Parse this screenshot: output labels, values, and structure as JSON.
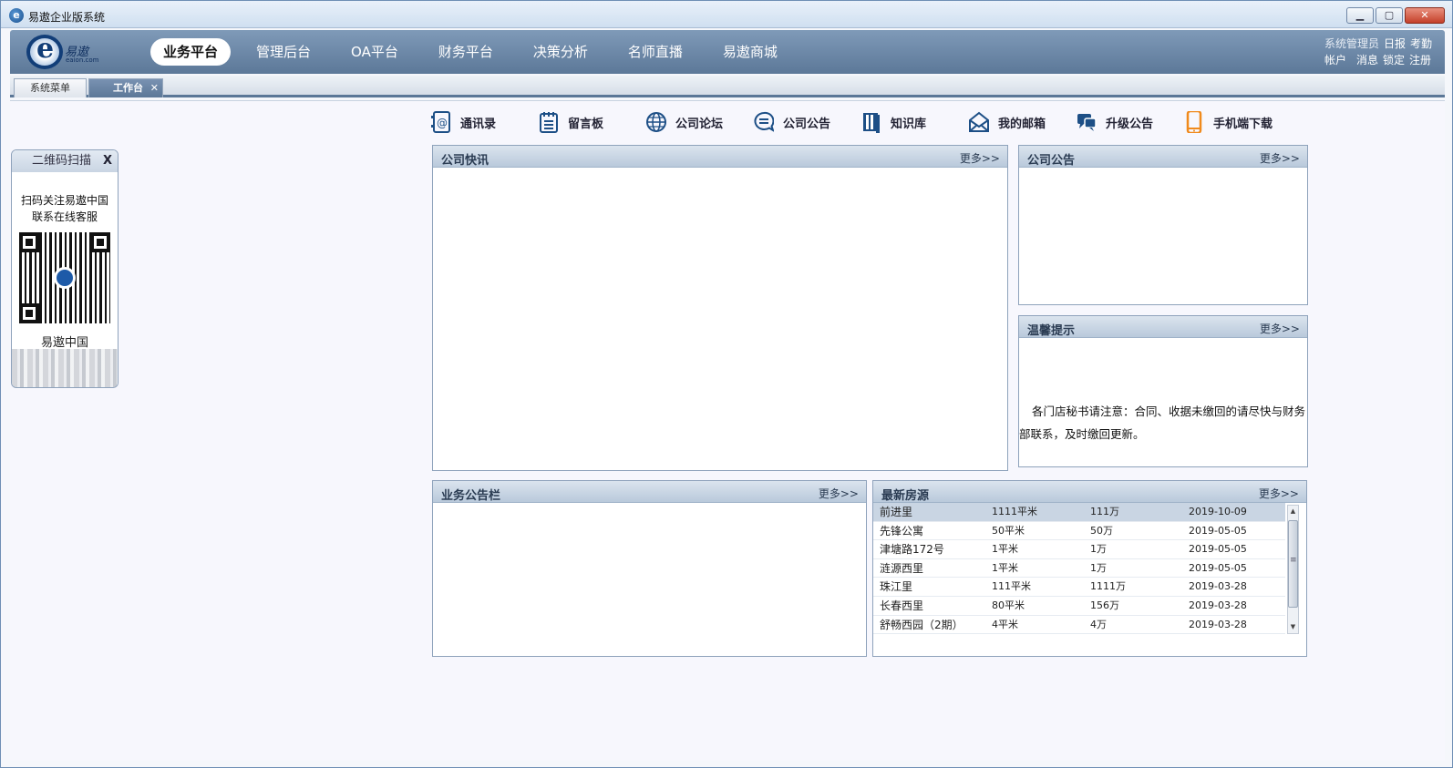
{
  "window": {
    "title": "易遨企业版系统",
    "min": "▁",
    "max": "▢",
    "close": "✕"
  },
  "logo": {
    "script": "易遨",
    "sub": "eaion.com"
  },
  "nav": [
    "业务平台",
    "管理后台",
    "OA平台",
    "财务平台",
    "决策分析",
    "名师直播",
    "易遨商城"
  ],
  "user": {
    "row1": [
      "系统管理员",
      "日报",
      "考勤"
    ],
    "row2": [
      "帐户",
      "消息",
      "锁定",
      "注册"
    ]
  },
  "tabs": {
    "menu": "系统菜单",
    "workbench": "工作台",
    "close": "✕"
  },
  "qr": {
    "title": "二维码扫描",
    "close": "X",
    "line1": "扫码关注易遨中国",
    "line2": "联系在线客服",
    "brand": "易遨中国"
  },
  "quicklinks": [
    {
      "label": "通讯录",
      "icon": "contacts-icon"
    },
    {
      "label": "留言板",
      "icon": "notepad-icon"
    },
    {
      "label": "公司论坛",
      "icon": "globe-icon"
    },
    {
      "label": "公司公告",
      "icon": "chat-icon"
    },
    {
      "label": "知识库",
      "icon": "book-icon"
    },
    {
      "label": "我的邮箱",
      "icon": "mail-icon"
    },
    {
      "label": "升级公告",
      "icon": "speech-icon"
    },
    {
      "label": "手机端下载",
      "icon": "phone-icon"
    }
  ],
  "panels": {
    "news": {
      "title": "公司快讯",
      "more": "更多>>"
    },
    "notice": {
      "title": "公司公告",
      "more": "更多>>"
    },
    "tips": {
      "title": "温馨提示",
      "more": "更多>>",
      "text": "各门店秘书请注意：合同、收据未缴回的请尽快与财务部联系，及时缴回更新。"
    },
    "biz": {
      "title": "业务公告栏",
      "more": "更多>>"
    },
    "houses": {
      "title": "最新房源",
      "more": "更多>>"
    }
  },
  "houses": [
    [
      "前进里",
      "1111平米",
      "111万",
      "2019-10-09"
    ],
    [
      "先锋公寓",
      "50平米",
      "50万",
      "2019-05-05"
    ],
    [
      "津塘路172号",
      "1平米",
      "1万",
      "2019-05-05"
    ],
    [
      "涟源西里",
      "1平米",
      "1万",
      "2019-05-05"
    ],
    [
      "珠江里",
      "111平米",
      "1111万",
      "2019-03-28"
    ],
    [
      "长春西里",
      "80平米",
      "156万",
      "2019-03-28"
    ],
    [
      "舒畅西园（2期）",
      "4平米",
      "4万",
      "2019-03-28"
    ]
  ],
  "colors": {
    "accent": "#5b7797",
    "header": "#7f9ab8",
    "orange": "#f08a1c",
    "iconBlue": "#1d4f86"
  }
}
